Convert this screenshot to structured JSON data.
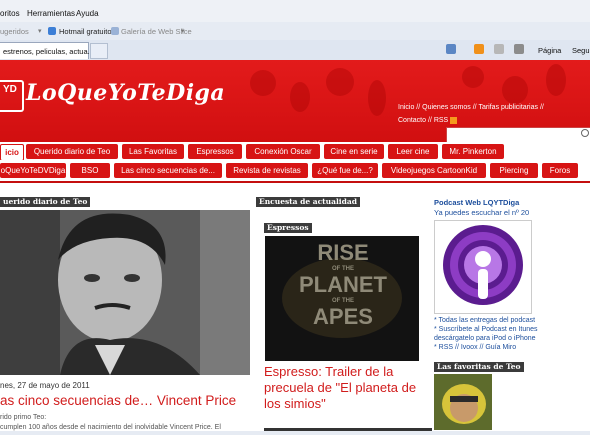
{
  "browser": {
    "menu": [
      "oritos",
      "Herramientas",
      "Ayuda"
    ],
    "favorites": {
      "suggested": "ugeridos",
      "hotmail": "Hotmail gratuito",
      "webslice": "Galería de Web Slice"
    },
    "tab_title": "estrenos, peliculas, actua...",
    "page_menu": "Página",
    "security_menu": "Segu"
  },
  "site": {
    "logo_abbr": "YD",
    "logo_text": "LoQueYoTeDiga",
    "toplinks": {
      "inicio": "Inicio",
      "sep1": "//",
      "quienes": "Quienes somos",
      "sep2": "//",
      "tarifas": "Tarifas publicitarias",
      "sep3": "//",
      "contacto": "Contacto",
      "sep4": "//",
      "rss": "RSS"
    },
    "search_placeholder": ""
  },
  "nav": {
    "row1": [
      "icio",
      "Querido diario de Teo",
      "Las Favoritas",
      "Espressos",
      "Conexión Oscar",
      "Cine en serie",
      "Leer cine",
      "Mr. Pinkerton"
    ],
    "row2": [
      "oQueYoTeDVDiga",
      "BSO",
      "Las cinco secuencias de...",
      "Revista de revistas",
      "¿Qué fue de...?",
      "Videojuegos CartoonKid",
      "Piercing",
      "Foros"
    ]
  },
  "main": {
    "section_label": "uerido diario de Teo",
    "date": "nes, 27 de mayo de 2011",
    "title": "as cinco secuencias de… Vincent Price",
    "text1": "rido primo Teo:",
    "text2": "cumplen 100 años desde el nacimiento del inolvidable Vincent Price. El"
  },
  "middle": {
    "section_label": "Encuesta de actualidad",
    "tag": "Espressos",
    "poster_text": [
      "RISE",
      "OF THE",
      "PLANET",
      "OF THE",
      "APES"
    ],
    "title": "Espresso: Trailer de la precuela de \"El planeta de los simios\""
  },
  "sidebar": {
    "podcast_title": "Podcast Web LQYTDiga",
    "podcast_sub": "Ya puedes escuchar el nº 20",
    "list": [
      "* Todas las entregas del podcast",
      "* Suscríbete al Podcast en Itunes",
      "  descárgatelo para iPod o iPhone",
      "* RSS // Ivoox // Guía Miro"
    ],
    "favs_label": "Las favoritas de Teo"
  },
  "colors": {
    "brand_red": "#d71414",
    "link_blue": "#1c4e9c",
    "podcast_purple": "#8d3cc4"
  }
}
